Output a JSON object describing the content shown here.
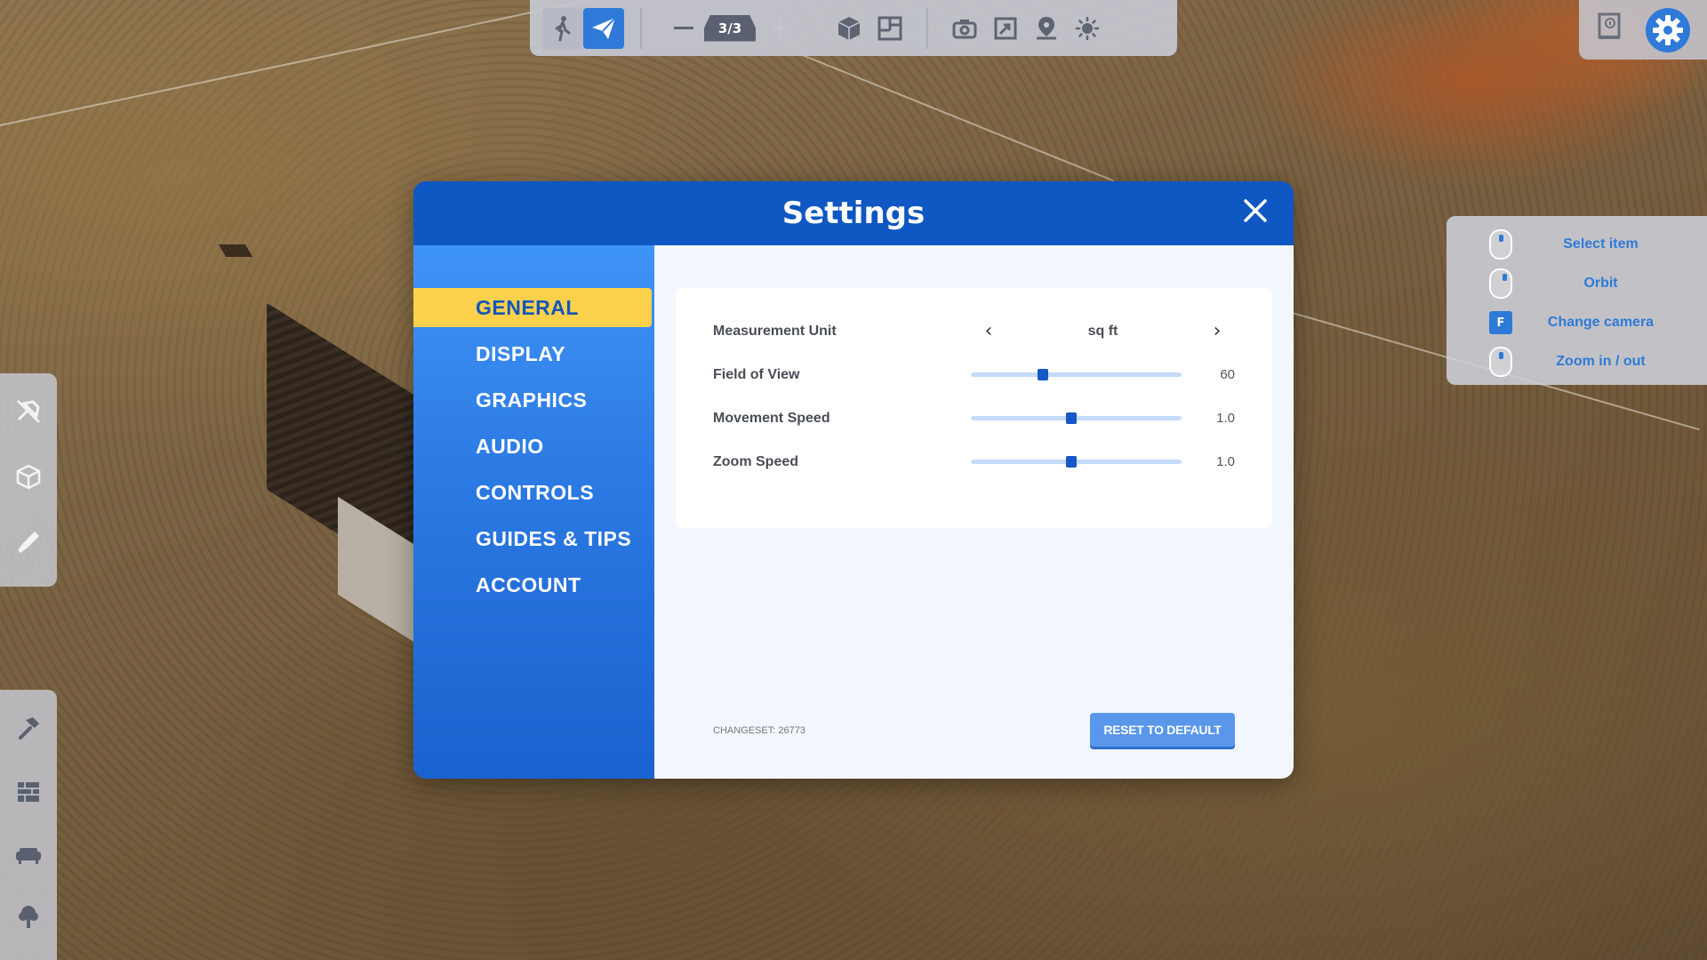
{
  "top_toolbar": {
    "level_indicator": "3/3"
  },
  "controls_hint": {
    "items": [
      {
        "label": "Select item",
        "key": ""
      },
      {
        "label": "Orbit",
        "key": ""
      },
      {
        "label": "Change camera",
        "key": "F"
      },
      {
        "label": "Zoom in / out",
        "key": ""
      }
    ]
  },
  "settings": {
    "title": "Settings",
    "nav": [
      {
        "label": "GENERAL",
        "active": true
      },
      {
        "label": "DISPLAY",
        "active": false
      },
      {
        "label": "GRAPHICS",
        "active": false
      },
      {
        "label": "AUDIO",
        "active": false
      },
      {
        "label": "CONTROLS",
        "active": false
      },
      {
        "label": "GUIDES & TIPS",
        "active": false
      },
      {
        "label": "ACCOUNT",
        "active": false
      }
    ],
    "general": {
      "measurement_unit": {
        "label": "Measurement Unit",
        "value": "sq ft"
      },
      "field_of_view": {
        "label": "Field of View",
        "value": "60",
        "fraction": 0.34
      },
      "movement_speed": {
        "label": "Movement Speed",
        "value": "1.0",
        "fraction": 0.475
      },
      "zoom_speed": {
        "label": "Zoom Speed",
        "value": "1.0",
        "fraction": 0.475
      }
    },
    "changeset": "CHANGESET: 26773",
    "reset_label": "RESET TO DEFAULT"
  },
  "colors": {
    "primary_blue": "#0f57c2",
    "accent_yellow": "#fbd14b",
    "button_blue": "#5a97ea"
  }
}
